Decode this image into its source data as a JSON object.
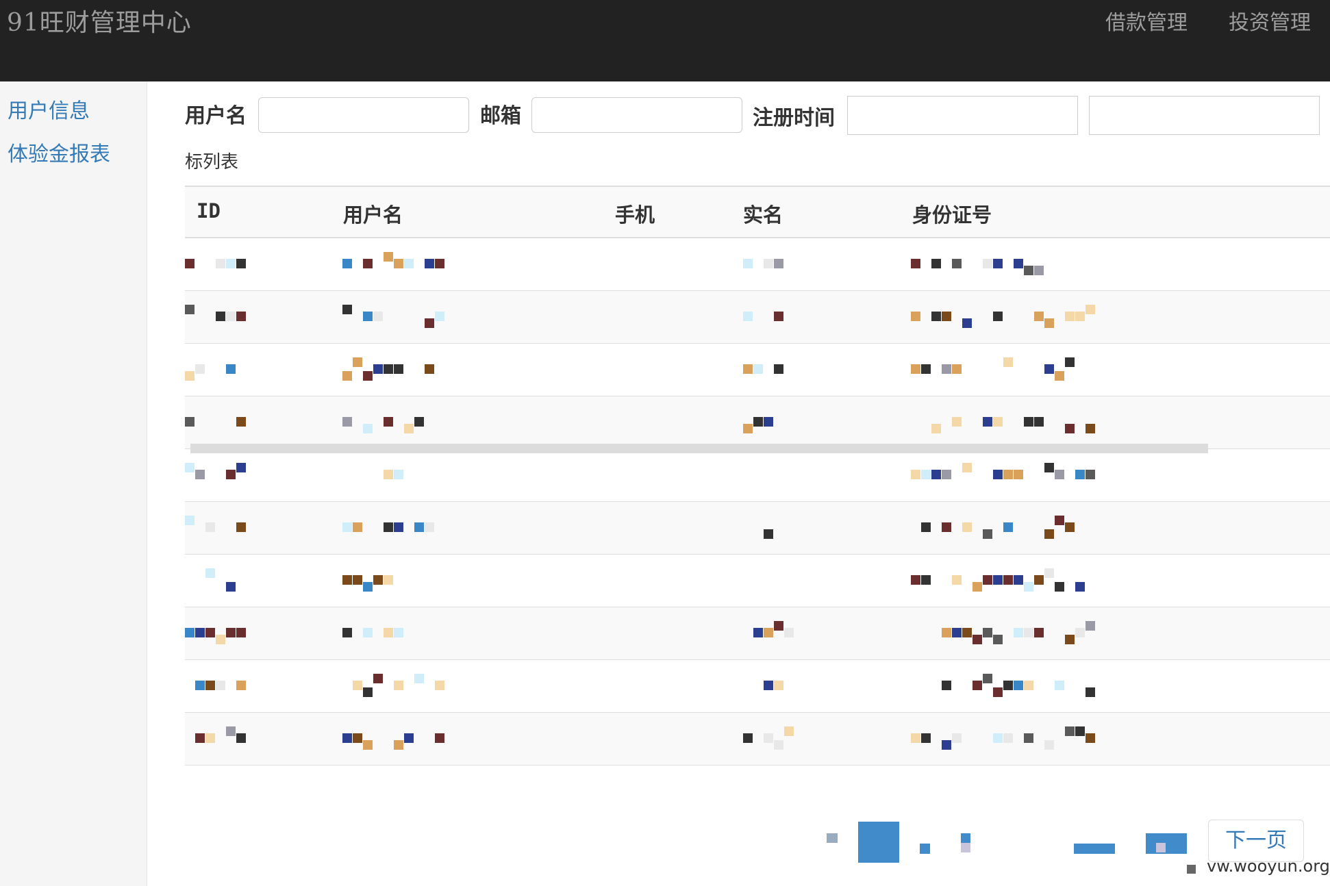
{
  "navbar": {
    "brand": "91旺财管理中心",
    "links": [
      "借款管理",
      "投资管理"
    ]
  },
  "sidebar": {
    "items": [
      "用户信息",
      "体验金报表"
    ]
  },
  "filters": {
    "username_label": "用户名",
    "email_label": "邮箱",
    "register_time_label": "注册时间",
    "username_value": "",
    "email_value": "",
    "start_value": "",
    "end_value": ""
  },
  "list": {
    "caption": "标列表",
    "columns": [
      "ID",
      "用户名",
      "手机",
      "实名",
      "身份证号"
    ],
    "row_count": 10,
    "note": ""
  },
  "pagination": {
    "next_label": "下一页"
  },
  "watermark": "vw.wooyun.org",
  "colors": {
    "navbar_bg": "#222222",
    "navbar_text": "#9d9d9d",
    "link": "#337ab7",
    "page_block": "#428bca"
  }
}
